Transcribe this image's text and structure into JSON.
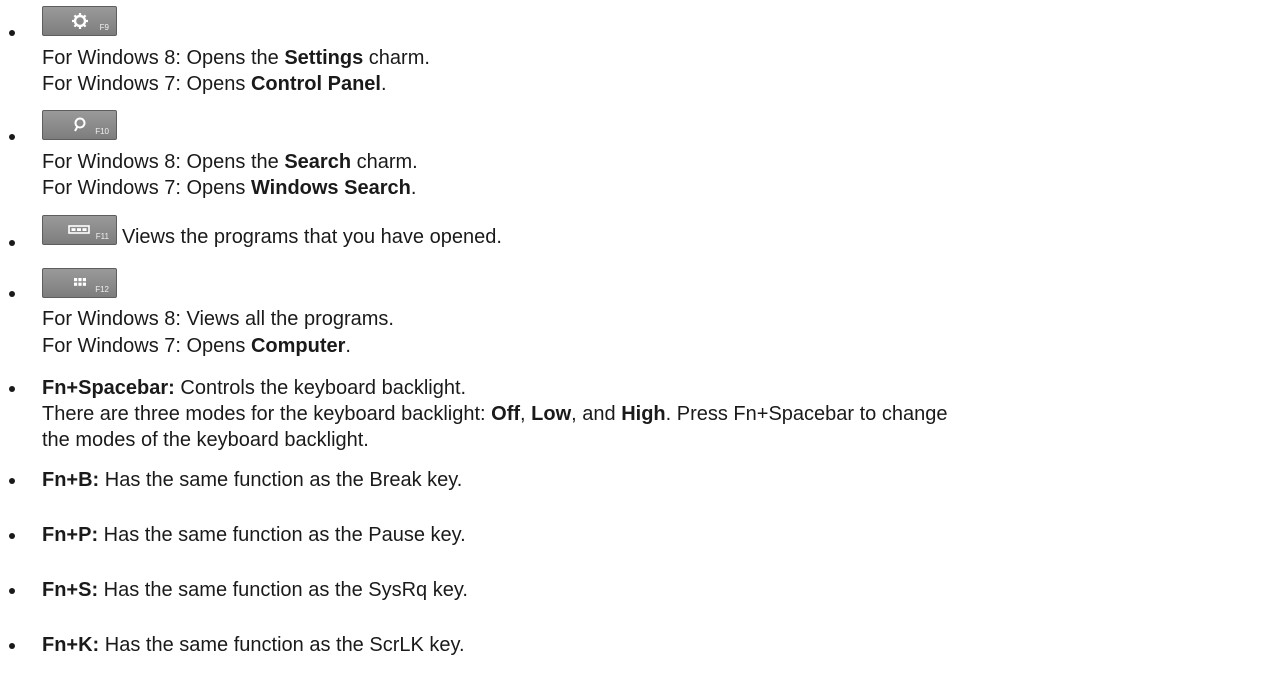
{
  "items": [
    {
      "key_label": "F9",
      "icon": "gear-icon",
      "lines": [
        {
          "pre": "For Windows 8: Opens the ",
          "bold": "Settings",
          "post": " charm."
        },
        {
          "pre": "For Windows 7: Opens ",
          "bold": "Control Panel",
          "post": "."
        }
      ]
    },
    {
      "key_label": "F10",
      "icon": "search-icon",
      "lines": [
        {
          "pre": "For Windows 8: Opens the ",
          "bold": "Search",
          "post": " charm."
        },
        {
          "pre": "For Windows 7: Opens ",
          "bold": "Windows Search",
          "post": "."
        }
      ]
    },
    {
      "key_label": "F11",
      "icon": "task-switch-icon",
      "desc": "Views the programs that you have opened."
    },
    {
      "key_label": "F12",
      "icon": "apps-grid-icon",
      "lines": [
        {
          "pre": "For Windows 8: Views all the programs.",
          "bold": "",
          "post": ""
        },
        {
          "pre": "For Windows 7: Opens ",
          "bold": "Computer",
          "post": "."
        }
      ]
    }
  ],
  "fn_spacebar": {
    "label": "Fn+Spacebar:",
    "text": " Controls the keyboard backlight.",
    "line2_pre": "There are three modes for the keyboard backlight: ",
    "mode1": "Off",
    "sep1": ", ",
    "mode2": "Low",
    "sep2": ", and ",
    "mode3": "High",
    "line2_post": ". Press Fn+Spacebar to change",
    "line3": "the modes of the keyboard backlight."
  },
  "fn_items": [
    {
      "label": "Fn+B:",
      "text": " Has the same function as the Break key."
    },
    {
      "label": "Fn+P:",
      "text": " Has the same function as the Pause key."
    },
    {
      "label": "Fn+S:",
      "text": " Has the same function as the SysRq key."
    },
    {
      "label": "Fn+K:",
      "text": " Has the same function as the ScrLK key."
    }
  ]
}
